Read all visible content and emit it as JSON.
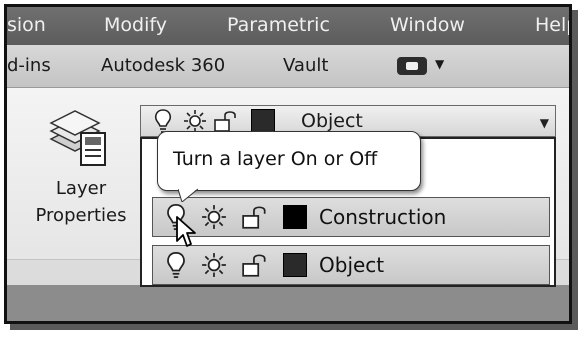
{
  "menubar": {
    "items": [
      "sion",
      "Modify",
      "Parametric",
      "Window",
      "Help"
    ]
  },
  "tabbar": {
    "items": [
      "d-ins",
      "Autodesk 360",
      "Vault"
    ]
  },
  "layer_properties": {
    "line1": "Layer",
    "line2": "Properties"
  },
  "layer_combo": {
    "selected": "Object"
  },
  "tooltip": {
    "text": "Turn a layer On or Off"
  },
  "layers": [
    {
      "name": "Construction",
      "color": "#000000"
    },
    {
      "name": "Object",
      "color": "#2a2a2a"
    }
  ],
  "colors": {
    "menubar": "#5c5c5c",
    "ribbon": "#eeeeee",
    "row": "#d0d0d0"
  }
}
